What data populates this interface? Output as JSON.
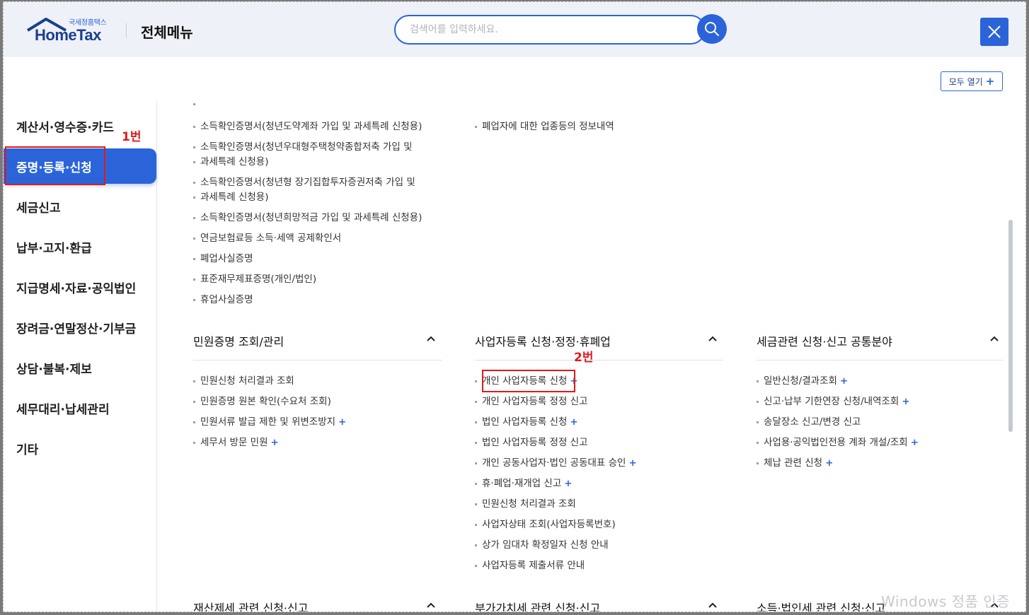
{
  "header": {
    "logo_sub": "국세청홈택스",
    "logo_main": "HomeTax",
    "menu_title": "전체메뉴",
    "search_placeholder": "검색어를 입력하세요.",
    "expand_all_label": "모두 열기"
  },
  "sidebar": {
    "items": [
      {
        "label": "계산서·영수증·카드"
      },
      {
        "label": "증명·등록·신청"
      },
      {
        "label": "세금신고"
      },
      {
        "label": "납부·고지·환급"
      },
      {
        "label": "지급명세·자료·공익법인"
      },
      {
        "label": "장려금·연말정산·기부금"
      },
      {
        "label": "상담·불복·제보"
      },
      {
        "label": "세무대리·납세관리"
      },
      {
        "label": "기타"
      }
    ],
    "annotation": "1번"
  },
  "top_col1_items": [
    {
      "label": "소득확인증명서(청년도약계좌 가입 및 과세특례 신청용)"
    },
    {
      "label": "소득확인증명서(청년우대형주택청약종합저축 가입 및"
    },
    {
      "label": "과세특례 신청용)"
    },
    {
      "label": "소득확인증명서(청년형 장기집합투자증권저축 가입 및"
    },
    {
      "label": "과세특례 신청용)"
    },
    {
      "label": "소득확인증명서(청년희망적금 가입 및 과세특례 신청용)"
    },
    {
      "label": "연금보험료등 소득·세액 공제확인서"
    },
    {
      "label": "폐업사실증명"
    },
    {
      "label": "표준재무제표증명(개인/법인)"
    },
    {
      "label": "휴업사실증명"
    }
  ],
  "top_col2_items": [
    {
      "label": "폐업자에 대한 업종등의 정보내역"
    }
  ],
  "sections": [
    {
      "title": "민원증명 조회/관리",
      "items": [
        {
          "label": "민원신청 처리결과 조회",
          "plus": ""
        },
        {
          "label": "민원증명 원본 확인(수요처 조회)",
          "plus": ""
        },
        {
          "label": "민원서류 발급 제한 및 위변조방지",
          "plus": "+"
        },
        {
          "label": "세무서 방문 민원",
          "plus": "+"
        }
      ]
    },
    {
      "title": "사업자등록 신청·정정·휴폐업",
      "annotation": "2번",
      "items": [
        {
          "label": "개인 사업자등록 신청",
          "plus": "+"
        },
        {
          "label": "개인 사업자등록 정정 신고",
          "plus": ""
        },
        {
          "label": "법인 사업자등록 신청",
          "plus": "+"
        },
        {
          "label": "법인 사업자등록 정정 신고",
          "plus": ""
        },
        {
          "label": "개인 공동사업자·법인 공동대표 승인",
          "plus": "+"
        },
        {
          "label": "휴·폐업·재개업 신고",
          "plus": "+"
        },
        {
          "label": "민원신청 처리결과 조회",
          "plus": ""
        },
        {
          "label": "사업자상태 조회(사업자등록번호)",
          "plus": ""
        },
        {
          "label": "상가 임대차 확정일자 신청 안내",
          "plus": ""
        },
        {
          "label": "사업자등록 제출서류 안내",
          "plus": ""
        }
      ]
    },
    {
      "title": "세금관련 신청·신고 공통분야",
      "items": [
        {
          "label": "일반신청/결과조회",
          "plus": "+"
        },
        {
          "label": "신고·납부 기한연장 신청/내역조회",
          "plus": "+"
        },
        {
          "label": "송달장소 신고/변경 신고",
          "plus": ""
        },
        {
          "label": "사업용·공익법인전용 계좌 개설/조회",
          "plus": "+"
        },
        {
          "label": "체납 관련 신청",
          "plus": "+"
        }
      ]
    }
  ],
  "bottom_sections": [
    {
      "title": "재산제세 관련 신청·신고"
    },
    {
      "title": "부가가치세 관련 신청·신고"
    },
    {
      "title": "소득·법인세 관련 신청·신고"
    }
  ],
  "watermark": "Windows 정품 인증",
  "colors": {
    "accent": "#2b64d9",
    "annotation": "#e01a1a"
  }
}
